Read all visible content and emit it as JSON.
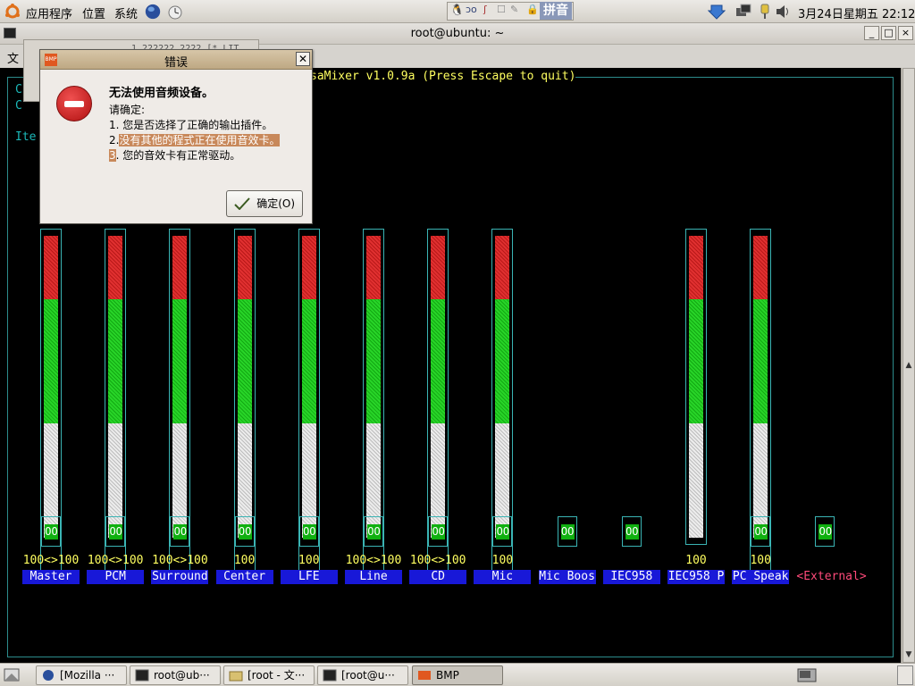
{
  "top_panel": {
    "menus": [
      "应用程序",
      "位置",
      "系统"
    ],
    "datetime": "3月24日星期五 22:12",
    "input_method_label": "拼音"
  },
  "terminal": {
    "title": "root@ubuntu: ~",
    "menu_first": "文",
    "partial_lines": [
      "C",
      "C",
      "Ite"
    ]
  },
  "background_window": {
    "partial_text": "1 222222   2222 [* LIT"
  },
  "mixer": {
    "title_text": "saMixer v1.0.9a (Press Escape to quit)",
    "channels": [
      {
        "label": "Master",
        "volume": "100<>100",
        "level": 1.0,
        "mute": "OO"
      },
      {
        "label": "PCM",
        "volume": "100<>100",
        "level": 1.0,
        "mute": "OO"
      },
      {
        "label": "Surround",
        "volume": "100<>100",
        "level": 1.0,
        "mute": "OO"
      },
      {
        "label": "Center",
        "volume": "100",
        "level": 1.0,
        "mute": "OO"
      },
      {
        "label": "LFE",
        "volume": "100",
        "level": 1.0,
        "mute": "OO"
      },
      {
        "label": "Line",
        "volume": "100<>100",
        "level": 1.0,
        "mute": "OO"
      },
      {
        "label": "CD",
        "volume": "100<>100",
        "level": 1.0,
        "mute": "OO"
      },
      {
        "label": "Mic",
        "volume": "100",
        "level": 1.0,
        "mute": "OO"
      },
      {
        "label": "Mic Boos",
        "volume": "",
        "level": null,
        "mute": "OO"
      },
      {
        "label": "IEC958",
        "volume": "",
        "level": null,
        "mute": "OO"
      },
      {
        "label": "IEC958 P",
        "volume": "100",
        "level": 1.0,
        "mute": ""
      },
      {
        "label": "PC Speak",
        "volume": "100",
        "level": 1.0,
        "mute": "OO"
      },
      {
        "label": "<External>",
        "volume": "",
        "level": null,
        "mute": "OO"
      }
    ]
  },
  "dialog": {
    "title": "错误",
    "app_icon_text": "BMP",
    "heading": "无法使用音频设备。",
    "intro": "请确定:",
    "items": [
      {
        "num": "1.",
        "text": "您是否选择了正确的输出插件。"
      },
      {
        "num": "2.",
        "text": "没有其他的程式正在使用音效卡。"
      },
      {
        "num": "3",
        "text": ". 您的音效卡有正常驱动。"
      }
    ],
    "ok_label": "确定(O)"
  },
  "taskbar": {
    "tasks": [
      "[Mozilla ···",
      "root@ub···",
      "[root - 文···",
      "[root@u···",
      "BMP"
    ]
  },
  "colors": {
    "terminal_bg": "#000000",
    "mixer_yellow": "#ffff60",
    "frame_cyan": "#2c8c8c",
    "label_blue": "#1818d8",
    "bar_red": "#e03030",
    "bar_green": "#28d428",
    "dialog_title": "#bea883"
  }
}
